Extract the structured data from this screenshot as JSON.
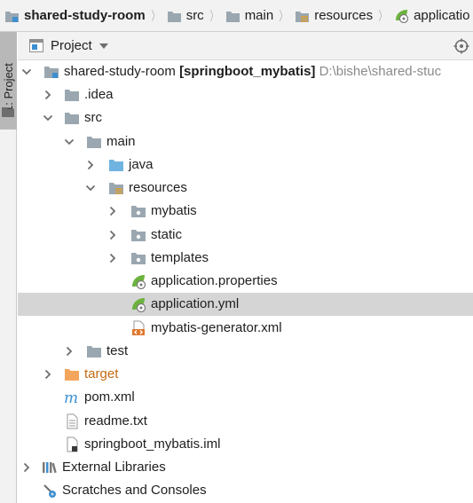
{
  "breadcrumb": [
    {
      "label": "shared-study-room",
      "icon": "module-icon",
      "bold": true
    },
    {
      "label": "src",
      "icon": "folder-icon"
    },
    {
      "label": "main",
      "icon": "folder-icon"
    },
    {
      "label": "resources",
      "icon": "resources-folder-icon"
    },
    {
      "label": "applicatio",
      "icon": "spring-config-icon"
    }
  ],
  "tool_window": {
    "tab_label": "1: Project"
  },
  "project_panel": {
    "title": "Project"
  },
  "tree": {
    "root": {
      "name": "shared-study-room",
      "module": "[springboot_mybatis]",
      "path": "D:\\bishe\\shared-stuc"
    },
    "idea": ".idea",
    "src": "src",
    "main": "main",
    "java": "java",
    "resources": "resources",
    "mybatis": "mybatis",
    "static": "static",
    "templates": "templates",
    "app_properties": "application.properties",
    "app_yml": "application.yml",
    "generator_xml": "mybatis-generator.xml",
    "test": "test",
    "target": "target",
    "pom": "pom.xml",
    "readme": "readme.txt",
    "iml": "springboot_mybatis.iml",
    "external_libraries": "External Libraries",
    "scratches": "Scratches and Consoles"
  },
  "colors": {
    "selection": "#d5d5d5",
    "folder": "#9aa7b0",
    "source_folder": "#6fb3e0",
    "target_folder": "#f4a55d",
    "target_text": "#c46a12",
    "spring_green": "#6cb33e"
  }
}
